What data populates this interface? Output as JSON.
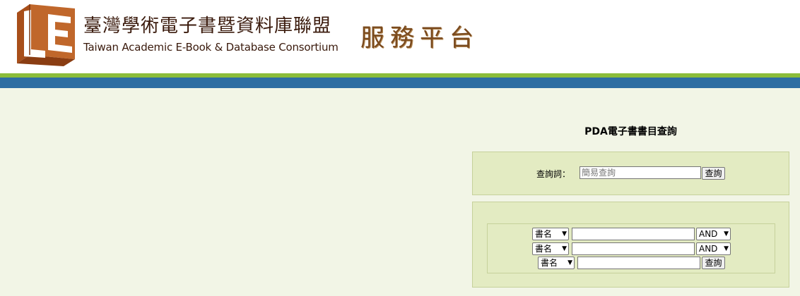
{
  "header": {
    "title_zh": "臺灣學術電子書暨資料庫聯盟",
    "title_en": "Taiwan Academic E-Book & Database Consortium",
    "platform_label": "服務平台",
    "logo_letters": "LE"
  },
  "page_title": "PDA電子書書目查詢",
  "simple_search": {
    "label": "查詢詞：",
    "placeholder": "簡易查詢",
    "button": "查詢"
  },
  "advanced_search": {
    "rows": [
      {
        "field": "書名",
        "value": "",
        "operator": "AND"
      },
      {
        "field": "書名",
        "value": "",
        "operator": "AND"
      },
      {
        "field": "書名",
        "value": ""
      }
    ],
    "button": "查詢"
  },
  "colors": {
    "logo": "#c0672b",
    "green_stripe": "#8bbd3a",
    "blue_stripe": "#2e6ea2",
    "panel": "#e3ebc2",
    "background": "#f2f5e6"
  },
  "icons": {
    "dropdown": "chevron-down-icon"
  }
}
